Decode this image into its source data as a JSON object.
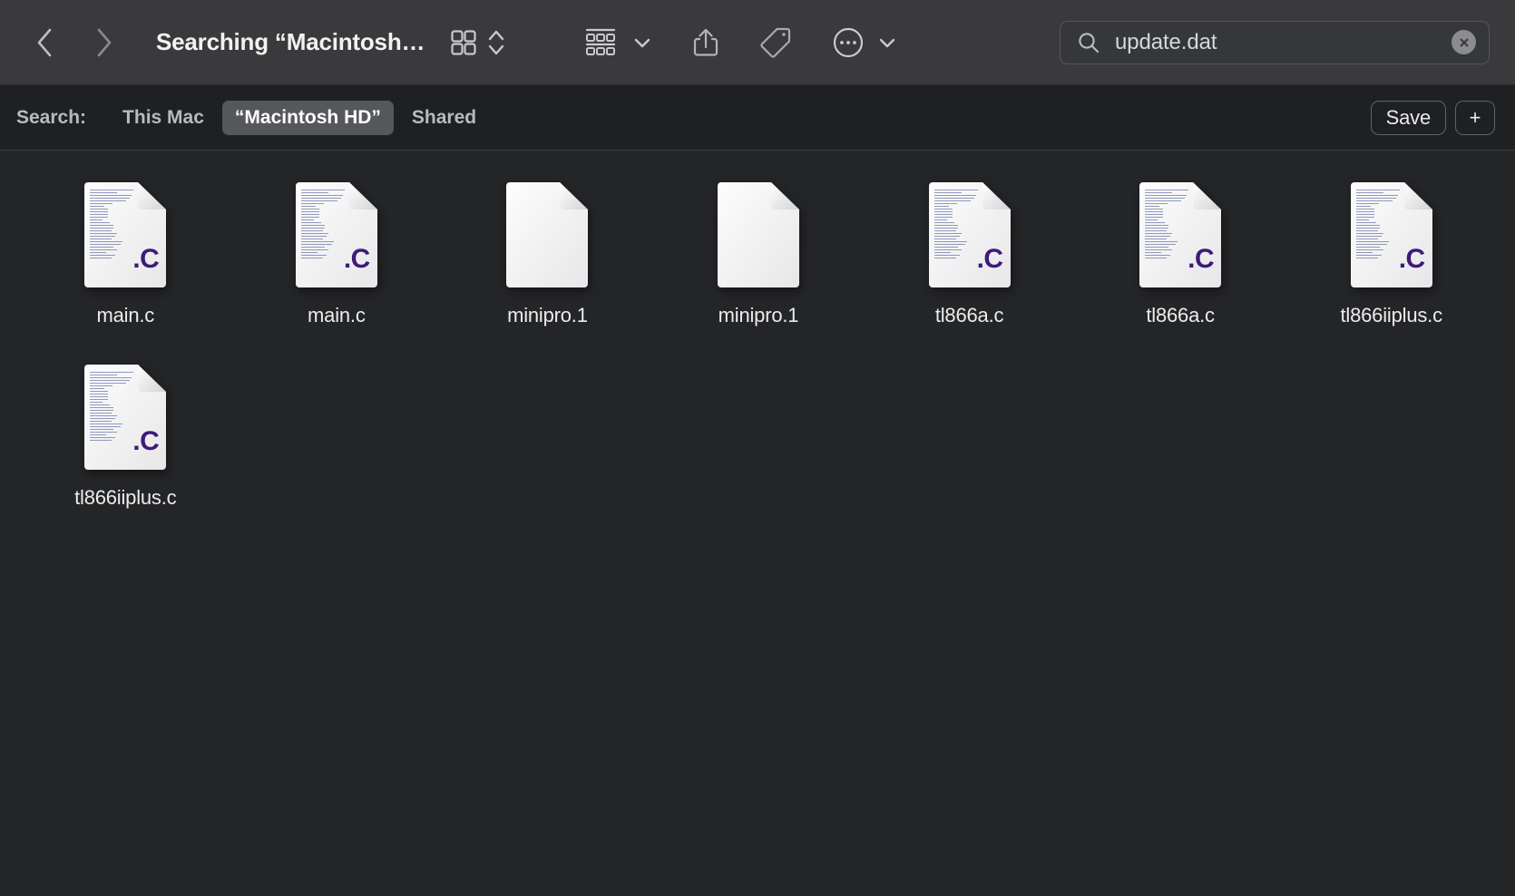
{
  "window": {
    "title": "Searching “Macintosh…",
    "background_color": "#242527",
    "toolbar_color": "#3a3a3c"
  },
  "toolbar": {
    "back_icon": "chevron-left-icon",
    "forward_icon": "chevron-right-icon",
    "view_icon": "icon-view-grid-icon",
    "view_sort_icon": "chevron-up-down-icon",
    "group_icon": "group-items-icon",
    "group_chevron_icon": "chevron-down-icon",
    "share_icon": "share-icon",
    "tag_icon": "tag-icon",
    "more_icon": "more-ellipsis-circle-icon",
    "more_chevron_icon": "chevron-down-icon"
  },
  "search": {
    "icon": "search-icon",
    "value": "update.dat",
    "placeholder": "Search",
    "clear_icon": "clear-circle-icon"
  },
  "scope_bar": {
    "label": "Search:",
    "items": [
      {
        "label": "This Mac",
        "selected": false
      },
      {
        "label": "“Macintosh HD”",
        "selected": true
      },
      {
        "label": "Shared",
        "selected": false
      }
    ],
    "selected_bg": "#56575a",
    "save_label": "Save",
    "add_label": "+"
  },
  "results": {
    "items": [
      {
        "name": "main.c",
        "icon": "c-source-file-icon",
        "badge": ".C",
        "kind": "code"
      },
      {
        "name": "main.c",
        "icon": "c-source-file-icon",
        "badge": ".C",
        "kind": "code"
      },
      {
        "name": "minipro.1",
        "icon": "generic-document-icon",
        "badge": "",
        "kind": "blank"
      },
      {
        "name": "minipro.1",
        "icon": "generic-document-icon",
        "badge": "",
        "kind": "blank"
      },
      {
        "name": "tl866a.c",
        "icon": "c-source-file-icon",
        "badge": ".C",
        "kind": "code"
      },
      {
        "name": "tl866a.c",
        "icon": "c-source-file-icon",
        "badge": ".C",
        "kind": "code"
      },
      {
        "name": "tl866iiplus.c",
        "icon": "c-source-file-icon",
        "badge": ".C",
        "kind": "code"
      },
      {
        "name": "tl866iiplus.c",
        "icon": "c-source-file-icon",
        "badge": ".C",
        "kind": "code"
      }
    ],
    "badge_color": "#3e1a79"
  }
}
